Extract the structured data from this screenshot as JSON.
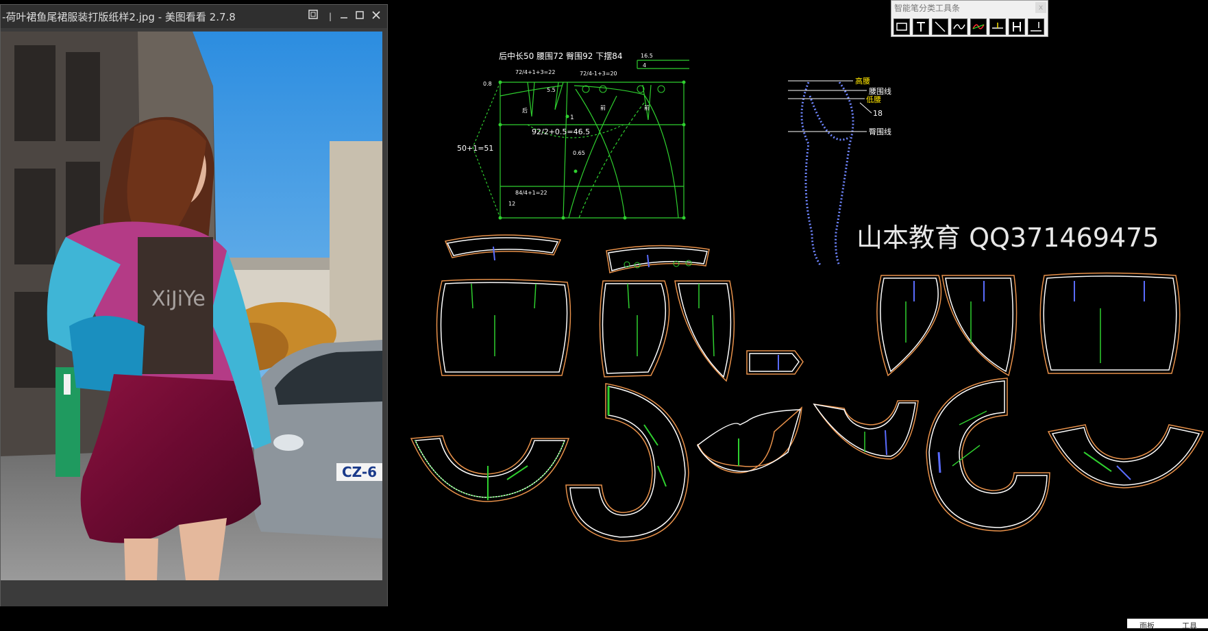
{
  "viewer": {
    "title": "-荷叶裙鱼尾裙服装打版纸样2.jpg - 美图看看 2.7.8",
    "photo_watermark": "XiJiYe",
    "plate_text": "CZ-6"
  },
  "toolbar": {
    "title": "智能笔分类工具条",
    "close_label": "x",
    "tools": [
      {
        "name": "rectangle-tool-icon"
      },
      {
        "name": "text-tool-icon",
        "label": "T"
      },
      {
        "name": "line-tool-icon"
      },
      {
        "name": "curve-tool-icon"
      },
      {
        "name": "red-curve-tool-icon"
      },
      {
        "name": "measure-tool-icon"
      },
      {
        "name": "h-tool-icon",
        "label": "H"
      },
      {
        "name": "mark-tool-icon"
      }
    ]
  },
  "draft": {
    "header": "后中长50   腰围72   臀围92   下摆84",
    "dim_165": "16.5",
    "dim_4": "4",
    "label_front_waist": "72/4+1+3=22",
    "label_back_waist": "72/4-1+3=20",
    "label_08": "0.8",
    "label_55": "5.5",
    "label_1": "1",
    "label_hip": "92/2+0.5=46.5",
    "label_length": "50+1=51",
    "label_065": "0.65",
    "label_hem": "84/4+1=22",
    "label_12": "12",
    "label_back": "后",
    "label_front": "前",
    "label_front2": "前"
  },
  "side_view": {
    "high_waist": "高腰",
    "waist_line": "腰围线",
    "low_waist": "低腰",
    "value_18": "18",
    "hip_line": "臀围线"
  },
  "watermark": "山本教育    QQ371469475",
  "corner_panel": {
    "left_label": "面板",
    "right_label": "工具"
  },
  "colors": {
    "pattern_outline": "#e8914a",
    "pattern_inner": "#ffffff",
    "construction_line": "#2fd02f",
    "blue_mark": "#5a6cff",
    "yellow_label": "#ffe600"
  }
}
